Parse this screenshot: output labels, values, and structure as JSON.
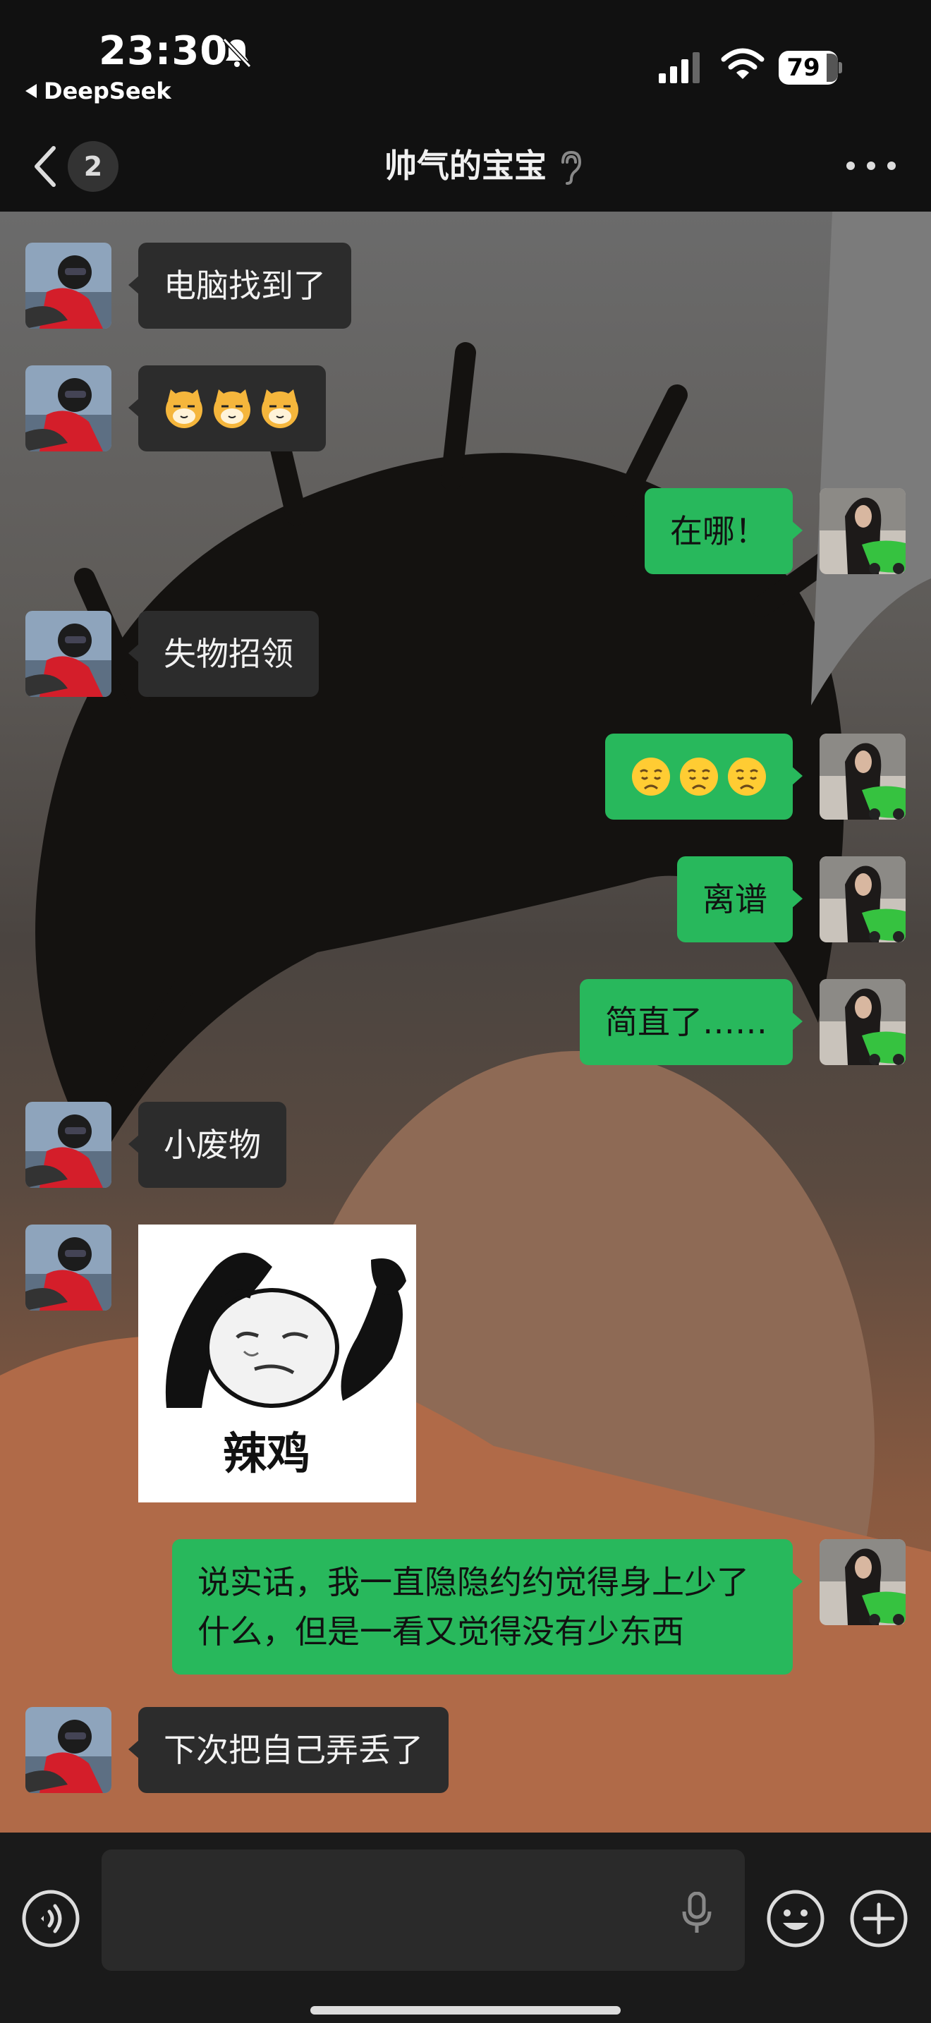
{
  "status_bar": {
    "time": "23:30",
    "back_app_label": "DeepSeek",
    "battery_level": "79",
    "icons": [
      "mute-bell-icon",
      "signal-icon",
      "wifi-icon",
      "battery-icon"
    ]
  },
  "nav": {
    "back_icon": "chevron-left-icon",
    "unread_count": "2",
    "title": "帅气的宝宝",
    "title_icon": "ear-icon",
    "more_icon": "ellipsis-icon"
  },
  "messages": [
    {
      "side": "in",
      "type": "text",
      "text": "电脑找到了"
    },
    {
      "side": "in",
      "type": "emoji",
      "emoji": [
        "cat-face-emoji",
        "cat-face-emoji",
        "cat-face-emoji"
      ]
    },
    {
      "side": "out",
      "type": "text",
      "text": "在哪！"
    },
    {
      "side": "in",
      "type": "text",
      "text": "失物招领"
    },
    {
      "side": "out",
      "type": "emoji",
      "emoji": [
        "disappointed-face-emoji",
        "disappointed-face-emoji",
        "disappointed-face-emoji"
      ]
    },
    {
      "side": "out",
      "type": "text",
      "text": "离谱"
    },
    {
      "side": "out",
      "type": "text",
      "text": "简直了……"
    },
    {
      "side": "in",
      "type": "text",
      "text": "小废物"
    },
    {
      "side": "in",
      "type": "sticker",
      "sticker_caption": "辣鸡"
    },
    {
      "side": "out",
      "type": "text",
      "text": "说实话，我一直隐隐约约觉得身上少了什么，但是一看又觉得没有少东西"
    },
    {
      "side": "in",
      "type": "text",
      "text": "下次把自己弄丢了"
    }
  ],
  "input_bar": {
    "placeholder": "",
    "icons": [
      "voice-icon",
      "mic-icon",
      "emoji-icon",
      "plus-icon"
    ]
  },
  "colors": {
    "outgoing_bubble": "#28b85c",
    "incoming_bubble": "#2c2c2c",
    "bar_background": "#111111"
  }
}
